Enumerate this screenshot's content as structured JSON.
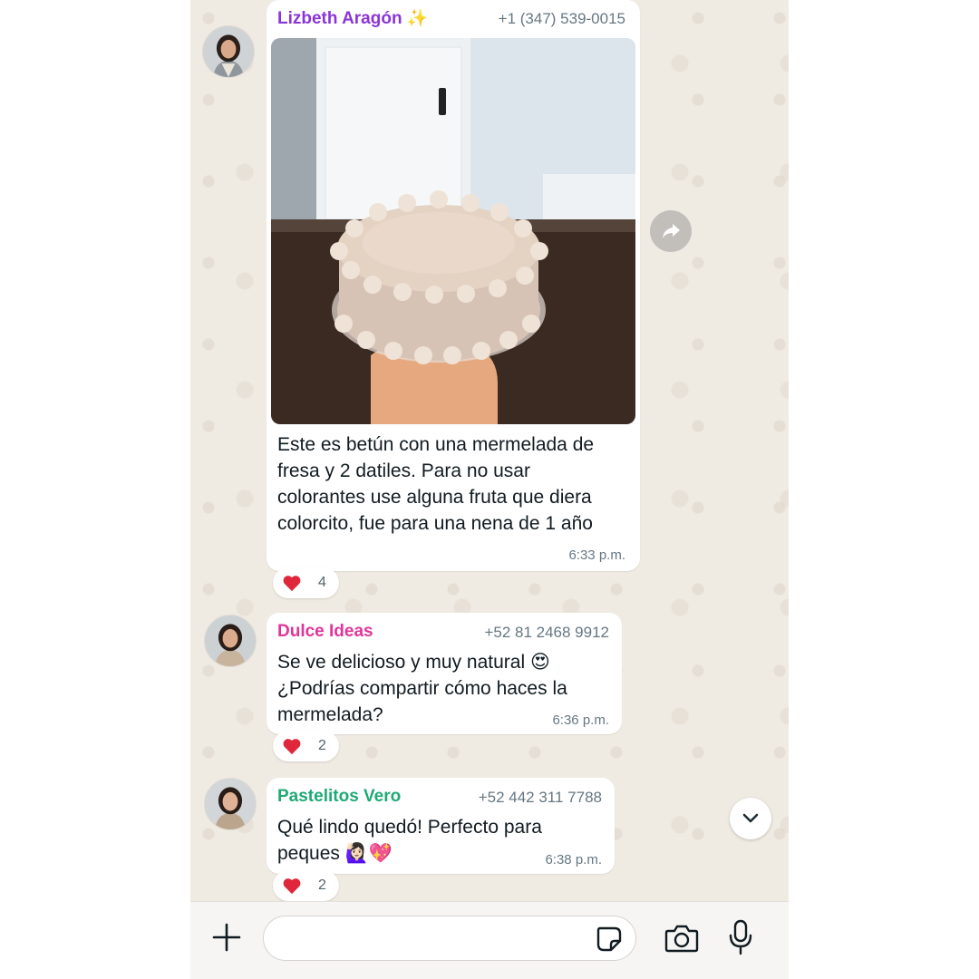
{
  "messages": [
    {
      "sender": "Lizbeth Aragón ✨",
      "sender_color": "#8a35d6",
      "phone": "+1 (347) 539-0015",
      "text": "Este es betún con una mermelada de fresa y 2 datiles. Para no usar colorantes use alguna fruta que diera colorcito, fue para una nena de 1 año",
      "time": "6:33 p.m.",
      "reaction": {
        "emoji": "heart",
        "count": "4"
      }
    },
    {
      "sender": "Dulce Ideas",
      "sender_color": "#e0349a",
      "phone": "+52  81 2468 9912",
      "text": "Se ve delicioso y muy natural 😍 ¿Podrías compartir cómo haces la mermelada?",
      "time": "6:36 p.m.",
      "reaction": {
        "emoji": "heart",
        "count": "2"
      }
    },
    {
      "sender": "Pastelitos Vero",
      "sender_color": "#1faa74",
      "phone": "+52 442 311 7788",
      "text": "Qué lindo quedó! Perfecto para peques 🙋🏻‍♀️💖",
      "time": "6:38 p.m.",
      "reaction": {
        "emoji": "heart",
        "count": "2"
      }
    }
  ],
  "composer": {
    "placeholder": "",
    "icons": [
      "plus-icon",
      "sticker-icon",
      "camera-icon",
      "microphone-icon"
    ]
  },
  "icons": {
    "forward": "forward-arrow-icon",
    "scroll_down": "chevron-down-icon"
  },
  "colors": {
    "chat_background": "#efeae2",
    "bubble": "#ffffff",
    "meta_text": "#667781",
    "heart": "#e0263a"
  }
}
